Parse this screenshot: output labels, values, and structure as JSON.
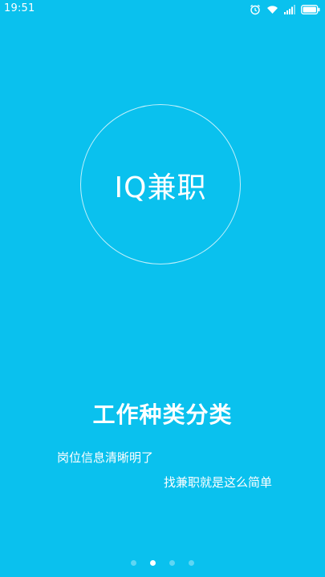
{
  "status_bar": {
    "time": "19:51",
    "icons": [
      "alarm-icon",
      "wifi-icon",
      "signal-icon",
      "battery-icon"
    ]
  },
  "logo": {
    "text": "IQ兼职"
  },
  "slide": {
    "headline": "工作种类分类",
    "line1": "岗位信息清晰明了",
    "line2": "找兼职就是这么简单"
  },
  "pager": {
    "count": 4,
    "active_index": 1
  },
  "colors": {
    "background": "#0ac1ee",
    "text": "#ffffff",
    "dot_inactive": "#5fd6f3",
    "dot_active": "#ffffff"
  }
}
